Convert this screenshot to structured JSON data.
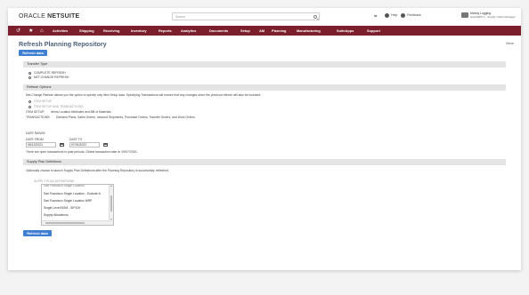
{
  "app": {
    "logo_prefix": "ORACLE",
    "logo_suffix": "NETSUITE",
    "search_placeholder": "Search",
    "help": "Help",
    "feedback": "Feedback",
    "user_name": "Manny Logging",
    "user_role": "SuiteMRS 2 - Supply Chain Manager"
  },
  "nav": {
    "items": [
      "Activities",
      "Shipping",
      "Receiving",
      "Inventory",
      "Reports",
      "Analytics",
      "Documents",
      "Setup",
      "AM",
      "Planning",
      "Manufacturing",
      "SuiteApps",
      "Support"
    ]
  },
  "page": {
    "title": "Refresh Planning Repository",
    "more": "More",
    "refresh_button": "Refresh data",
    "refresh_button_bottom": "Refresh data"
  },
  "transfer_type": {
    "header": "Transfer Type",
    "options": [
      "COMPLETE REFRESH",
      "NET-CHANGE REFRESH"
    ],
    "selected": "COMPLETE REFRESH"
  },
  "refresh_options": {
    "header": "Refresh Options",
    "description": "Net-Change Refresh allows you the option to specify only item Setup data. Specifying Transactions will ensure that any changes since the previous refresh will also be included.",
    "options": [
      "ITEM SETUP",
      "ITEM SETUP AND TRANSACTIONS"
    ],
    "item_setup_label": "ITEM SETUP:",
    "item_setup_value": "Items,Location Attributes and Bill of Materials",
    "transactions_label": "TRANSACTIONS:",
    "transactions_value": "Demand Plans, Sales Orders, Inbound Shipments, Purchase Orders, Transfer Orders, and Work Orders",
    "date_range_label": "DATE RANGE",
    "date_from_label": "DATE FROM",
    "date_from_value": "06/12/2021",
    "date_to_label": "DATE TO",
    "date_to_value": "07/01/2022",
    "note": "There are open transactions in past periods. Oldest transaction date is: 09/07/2020."
  },
  "supply_plan": {
    "header": "Supply Plan Definitions",
    "description": "Optionally choose to launch Supply Plan Definitions after the Planning Repository is successfully refreshed.",
    "list_label": "SUPPLY PLAN DEFINITIONS",
    "list_items": [
      "San Francisco Single Location",
      "San Francisco Single Location - Exclude A",
      "San Francisco Single Location MRP",
      "Single Level BOM - SIP100",
      "Supply Allocations"
    ]
  },
  "colors": {
    "nav_bg": "#7c1f2d",
    "button_bg": "#3f7fd1",
    "title": "#4d5f79"
  },
  "icons": [
    "search-icon",
    "help-icon",
    "feedback-icon",
    "user-icon",
    "recent-icon",
    "star-icon",
    "home-icon",
    "calendar-icon",
    "scroll-up-icon",
    "scroll-down-icon"
  ]
}
